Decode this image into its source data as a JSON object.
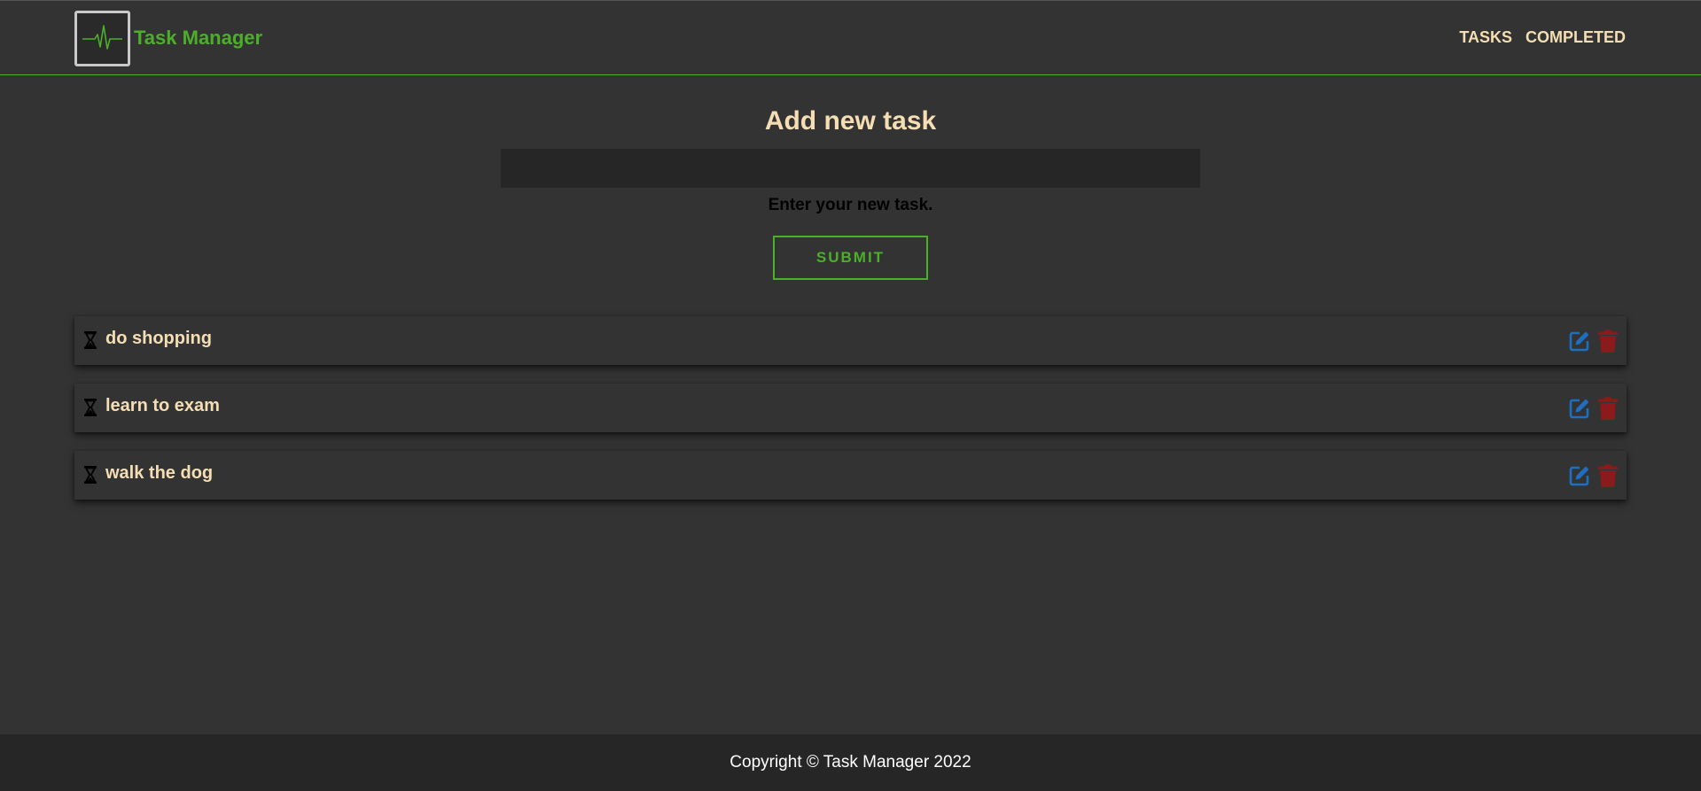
{
  "header": {
    "brand": "Task Manager",
    "logo_icon": "heartbeat-monitor-icon",
    "nav": [
      {
        "label": "TASKS"
      },
      {
        "label": "COMPLETED"
      }
    ]
  },
  "form": {
    "title": "Add new task",
    "input_value": "",
    "input_placeholder": "",
    "helper": "Enter your new task.",
    "submit_label": "SUBMIT"
  },
  "tasks": [
    {
      "text": "do shopping",
      "status_icon": "hourglass-icon"
    },
    {
      "text": "learn to exam",
      "status_icon": "hourglass-icon"
    },
    {
      "text": "walk the dog",
      "status_icon": "hourglass-icon"
    }
  ],
  "footer": {
    "copyright": "Copyright © Task Manager 2022"
  },
  "colors": {
    "accent": "#4caf2a",
    "text": "#f5deb3",
    "background": "#333333",
    "input_bg": "#262626",
    "edit": "#1e6fc2",
    "delete": "#8b1a1a"
  }
}
